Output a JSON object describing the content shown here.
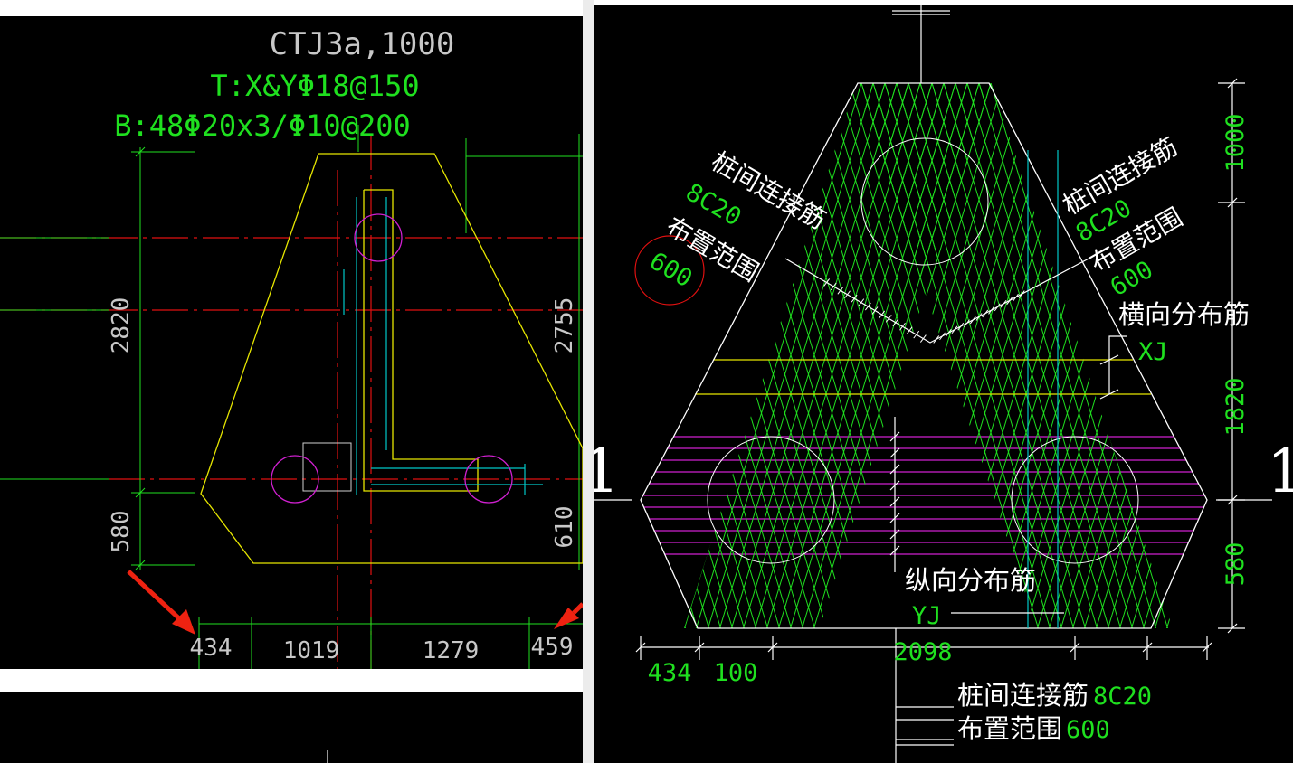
{
  "left": {
    "title": "CTJ3a,1000",
    "top_rebar": "T:X&YΦ18@150",
    "bottom_rebar": "B:48Φ20x3/Φ10@200",
    "dim_left_upper": "2820",
    "dim_left_lower": "580",
    "dim_right_upper": "2755",
    "dim_right_lower": "610",
    "bottom_dims": [
      "434",
      "1019",
      "1279",
      "459"
    ]
  },
  "right": {
    "section_mark": "1",
    "left_label_line1": "桩间连接筋",
    "left_label_value": "8C20",
    "left_label_line2": "布置范围",
    "left_label_range": "600",
    "right_label_line1": "桩间连接筋",
    "right_label_value": "8C20",
    "right_label_line2": "布置范围",
    "right_label_range": "600",
    "transverse_label": "横向分布筋",
    "transverse_code": "XJ",
    "longitudinal_label": "纵向分布筋",
    "longitudinal_code": "YJ",
    "dim_right": [
      "1000",
      "1820",
      "580"
    ],
    "dim_bottom": [
      "434",
      "100",
      "2098"
    ],
    "note1_text": "桩间连接筋",
    "note1_value": "8C20",
    "note2_text": "布置范围",
    "note2_value": "600"
  },
  "colors": {
    "background": "#000000",
    "green": "#1fe01f",
    "yellow": "#e6e600",
    "red": "#e01010",
    "magenta": "#d020d0",
    "cyan": "#00c8c8",
    "white": "#ffffff",
    "arrow_red": "#ee2211",
    "cad_gray": "#c8c8c8"
  },
  "icons": [
    "arrow-pointer-icon",
    "arrow-pointer-icon"
  ]
}
